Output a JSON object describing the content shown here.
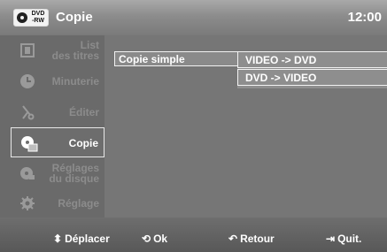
{
  "header": {
    "logo_top": "DVD",
    "logo_bottom": "-RW",
    "title": "Copie",
    "clock": "12:00"
  },
  "sidebar": {
    "items": [
      {
        "label_line1": "List",
        "label_line2": "des titres",
        "icon": "film-icon",
        "active": false
      },
      {
        "label_line1": "Minuterie",
        "label_line2": "",
        "icon": "clock-icon",
        "active": false
      },
      {
        "label_line1": "Éditer",
        "label_line2": "",
        "icon": "scissors-icon",
        "active": false
      },
      {
        "label_line1": "Copie",
        "label_line2": "",
        "icon": "copy-disc-icon",
        "active": true
      },
      {
        "label_line1": "Réglages",
        "label_line2": "du disque",
        "icon": "disc-settings-icon",
        "active": false
      },
      {
        "label_line1": "Réglage",
        "label_line2": "",
        "icon": "gear-icon",
        "active": false
      }
    ]
  },
  "main": {
    "option_label": "Copie simple",
    "submenu": [
      {
        "label": "VIDEO -> DVD"
      },
      {
        "label": "DVD -> VIDEO"
      }
    ]
  },
  "footer": {
    "move": {
      "glyph": "⬍",
      "label": "Déplacer"
    },
    "ok": {
      "glyph": "⟲",
      "label": "Ok"
    },
    "back": {
      "glyph": "↶",
      "label": "Retour"
    },
    "quit": {
      "glyph": "⇥",
      "label": "Quit."
    }
  }
}
